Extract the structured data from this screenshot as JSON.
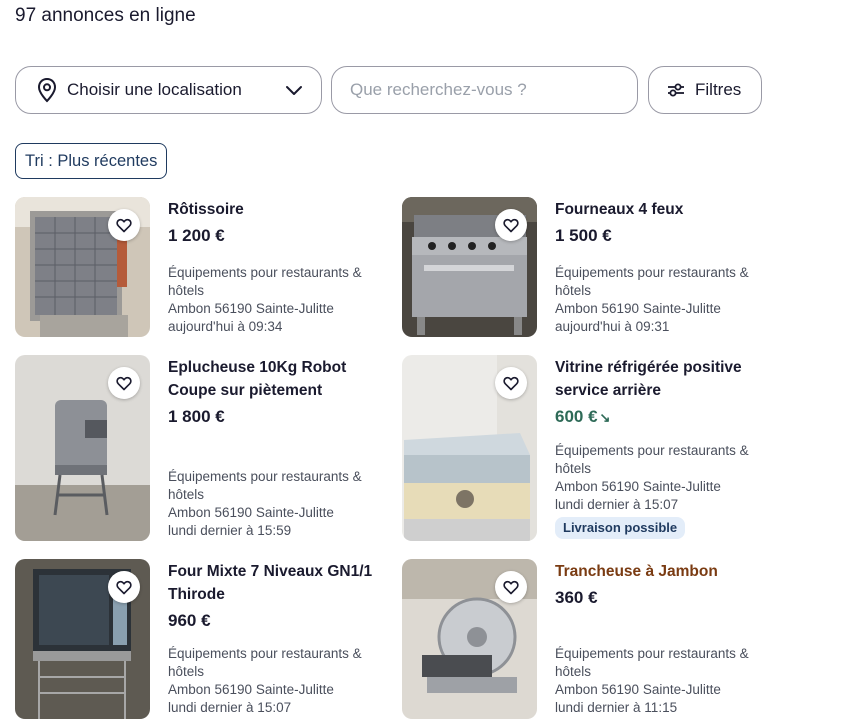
{
  "results_count_text": "97 annonces en ligne",
  "filters": {
    "location_label": "Choisir une localisation",
    "search_placeholder": "Que recherchez-vous ?",
    "filters_label": "Filtres"
  },
  "sort_label": "Tri : Plus récentes",
  "listings": [
    {
      "title": "Rôtissoire",
      "price": "1 200 €",
      "category": "Équipements pour restaurants & hôtels",
      "location": "Ambon 56190 Sainte-Julitte",
      "date": "aujourd'hui à 09:34",
      "image": "rotisserie"
    },
    {
      "title": "Fourneaux 4 feux",
      "price": "1 500 €",
      "category": "Équipements pour restaurants & hôtels",
      "location": "Ambon 56190 Sainte-Julitte",
      "date": "aujourd'hui à 09:31",
      "image": "stove"
    },
    {
      "title": "Eplucheuse 10Kg Robot Coupe sur piètement",
      "price": "1 800 €",
      "category": "Équipements pour restaurants & hôtels",
      "location": "Ambon 56190 Sainte-Julitte",
      "date": "lundi dernier à 15:59",
      "image": "peeler"
    },
    {
      "title": "Vitrine réfrigérée positive service arrière",
      "price": "600 €",
      "price_color": "#2e6a57",
      "price_trend_icon": "trend-down-icon",
      "category": "Équipements pour restaurants & hôtels",
      "location": "Ambon 56190 Sainte-Julitte",
      "date": "lundi dernier à 15:07",
      "badge": "Livraison possible",
      "image": "display-fridge"
    },
    {
      "title": "Four Mixte 7 Niveaux GN1/1 Thirode",
      "price": "960 €",
      "category": "Équipements pour restaurants & hôtels",
      "location": "Ambon 56190 Sainte-Julitte",
      "date": "lundi dernier à 15:07",
      "image": "combi-oven"
    },
    {
      "title": "Trancheuse à Jambon",
      "title_color": "#7a3b12",
      "price": "360 €",
      "category": "Équipements pour restaurants & hôtels",
      "location": "Ambon 56190 Sainte-Julitte",
      "date": "lundi dernier à 11:15",
      "image": "slicer"
    }
  ]
}
